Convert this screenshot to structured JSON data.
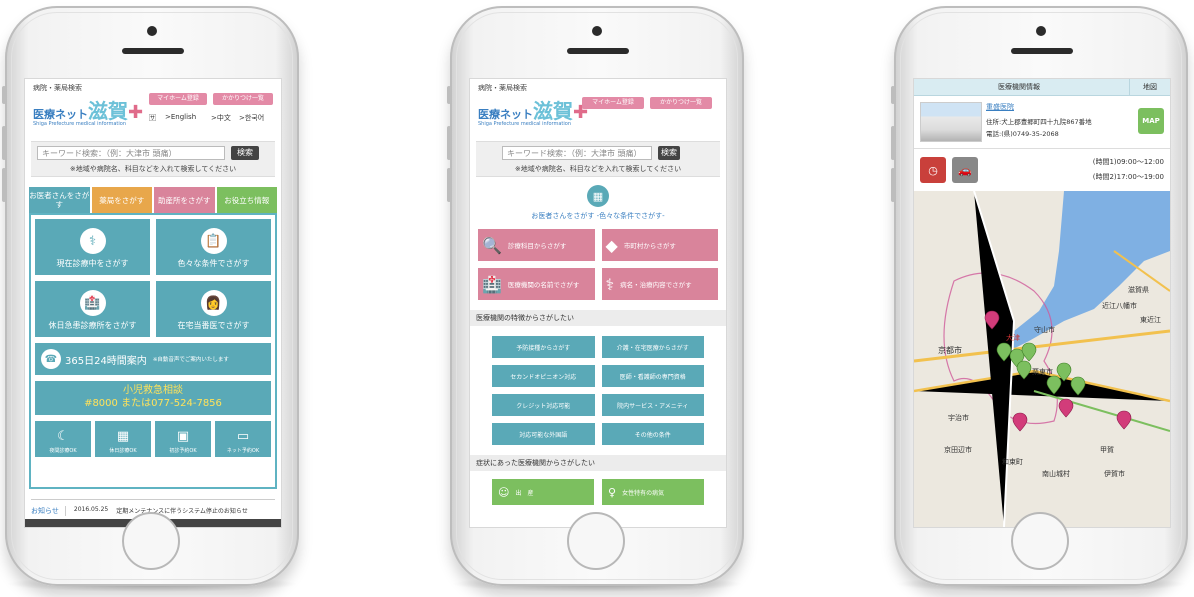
{
  "phone1": {
    "logo_top": "病院・薬局検索",
    "logo_main": "医療ネット",
    "logo_big": "滋賀",
    "logo_sub": "Shiga Prefecture medical information",
    "btn_my_home": "マイホーム登録",
    "btn_kakaritsuke": "かかりつけ一覧",
    "lang": [
      ">English",
      ">中文",
      ">한국어"
    ],
    "search_placeholder": "キーワード検索：（例：大津市 頭痛）",
    "search_button": "検索",
    "search_hint": "※地域や病院名、科目などを入れて検索してください",
    "tabs": [
      "お医者さんをさがす",
      "薬局をさがす",
      "助産所をさがす",
      "お役立ち情報"
    ],
    "tiles": [
      "現在診療中をさがす",
      "色々な条件でさがす",
      "休日急患診療所をさがす",
      "在宅当番医でさがす"
    ],
    "guide_title": "365日24時間案内",
    "guide_note": "※自動音声でご案内いたします",
    "consult_title": "小児救急相談",
    "consult_number": "#8000 または077-524-7856",
    "small_tiles": [
      "夜間診療OK",
      "休日診療OK",
      "初診予約OK",
      "ネット予約OK"
    ],
    "news_label": "お知らせ",
    "news_date": "2016.05.25",
    "news_text": "定期メンテナンスに伴うシステム停止のお知らせ"
  },
  "phone2": {
    "logo_top": "病院・薬局検索",
    "logo_main": "医療ネット",
    "logo_big": "滋賀",
    "logo_sub": "Shiga Prefecture medical information",
    "btn_my_home": "マイホーム登録",
    "btn_kakaritsuke": "かかりつけ一覧",
    "search_placeholder": "キーワード検索：（例：大津市 頭痛）",
    "search_button": "検索",
    "search_hint": "※地域や病院名、科目などを入れて検索してください",
    "heading": "お医者さんをさがす -色々な条件でさがす-",
    "pink_tiles": [
      "診療科目からさがす",
      "市町村からさがす",
      "医療機関の名前でさがす",
      "病名・治療内容でさがす"
    ],
    "section1": "医療機関の特徴からさがしたい",
    "teal_buttons": [
      "予防接種からさがす",
      "介護・在宅医療からさがす",
      "セカンドオピニオン対応",
      "医師・看護師の専門資格",
      "クレジット対応可能",
      "院内サービス・アメニティ",
      "対応可能な外国語",
      "その他の条件"
    ],
    "section2": "症状にあった医療機関からさがしたい",
    "green_buttons": [
      "出　産",
      "女性特有の病気"
    ]
  },
  "phone3": {
    "bar_title": "医療機関情報",
    "bar_map": "地図",
    "hospital_name": "重盛医院",
    "address": "住所:犬上郡豊郷町四十九院867番地",
    "phone": "電話:(県)0749-35-2068",
    "map_button": "MAP",
    "hours1": "(時間1)09:00～12:00",
    "hours2": "(時間2)17:00～19:00",
    "map_labels": [
      "滋賀県",
      "近江八幡市",
      "東近江",
      "守山市",
      "京都市",
      "大津",
      "栗東市",
      "宇治市",
      "京田辺市",
      "甲賀",
      "伊賀市",
      "南山城村",
      "和束町"
    ]
  },
  "colors": {
    "teal": "#5aa9b7",
    "pink": "#d9849b",
    "green": "#7cbf5f",
    "blue": "#3a7fc1",
    "lake": "#7fb0e3"
  }
}
